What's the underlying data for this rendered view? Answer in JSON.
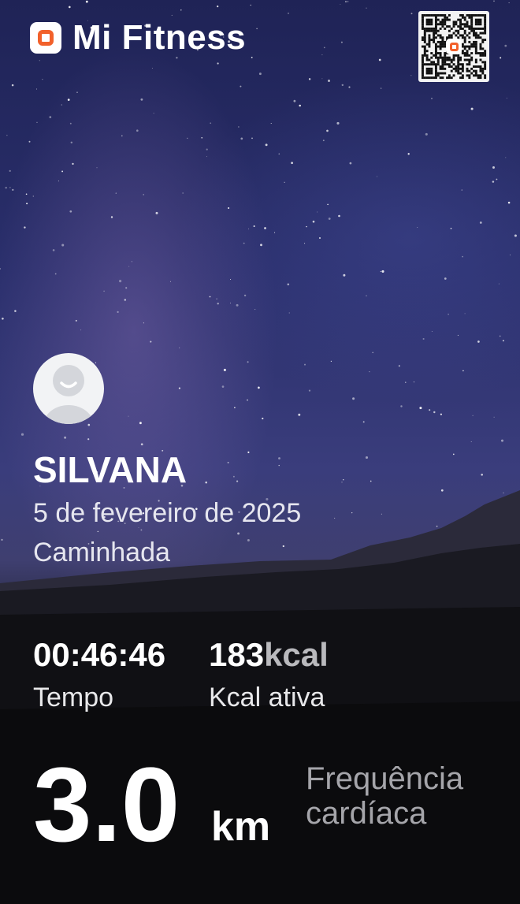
{
  "app": {
    "title": "Mi Fitness",
    "accent_color": "#f2612b",
    "logo_icon": "mi-fitness-logo-icon",
    "qr_icon": "qr-code-icon"
  },
  "profile": {
    "name": "SILVANA",
    "date": "5 de fevereiro de 2025",
    "activity": "Caminhada",
    "avatar_icon": "default-avatar-icon"
  },
  "stats": {
    "time": {
      "value": "00:46:46",
      "label": "Tempo"
    },
    "calories": {
      "value": "183",
      "unit": "kcal",
      "label": "Kcal ativa"
    }
  },
  "distance": {
    "value": "3.0",
    "unit": "km"
  },
  "metric_label": {
    "line1": "Frequência",
    "line2": "cardíaca"
  }
}
